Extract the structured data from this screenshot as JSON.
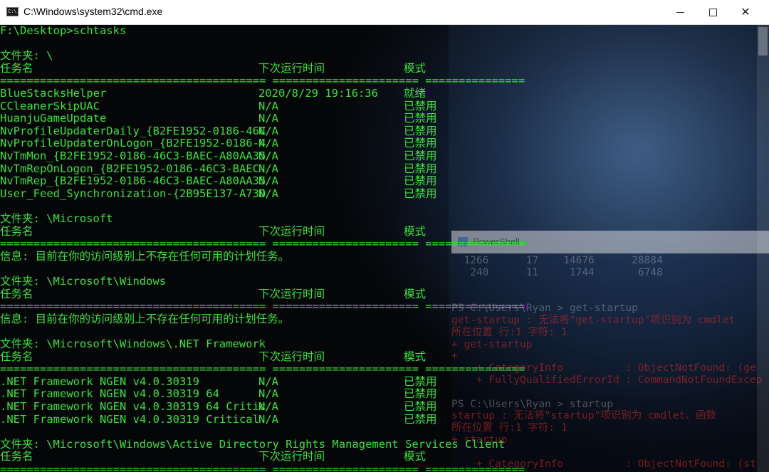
{
  "window": {
    "title": "C:\\Windows\\system32\\cmd.exe",
    "icon_text": "C:\\.",
    "controls": {
      "minimize": "minimize",
      "maximize": "maximize",
      "close": "✕"
    }
  },
  "console": {
    "prompt": "F:\\Desktop>schtasks",
    "sections": [
      {
        "folder": "文件夹: \\",
        "header": {
          "name": "任务名",
          "next_run": "下次运行时间",
          "status": "模式"
        },
        "separator": "======================================== ====================== ===============",
        "rows": [
          {
            "name": "BlueStacksHelper",
            "next_run": "2020/8/29 19:16:36",
            "status": "就绪"
          },
          {
            "name": "CCleanerSkipUAC",
            "next_run": "N/A",
            "status": "已禁用"
          },
          {
            "name": "HuanjuGameUpdate",
            "next_run": "N/A",
            "status": "已禁用"
          },
          {
            "name": "NvProfileUpdaterDaily_{B2FE1952-0186-46C",
            "next_run": "N/A",
            "status": "已禁用"
          },
          {
            "name": "NvProfileUpdaterOnLogon_{B2FE1952-0186-4",
            "next_run": "N/A",
            "status": "已禁用"
          },
          {
            "name": "NvTmMon_{B2FE1952-0186-46C3-BAEC-A80AA35",
            "next_run": "N/A",
            "status": "已禁用"
          },
          {
            "name": "NvTmRepOnLogon_{B2FE1952-0186-46C3-BAEC-",
            "next_run": "N/A",
            "status": "已禁用"
          },
          {
            "name": "NvTmRep_{B2FE1952-0186-46C3-BAEC-A80AA35",
            "next_run": "N/A",
            "status": "已禁用"
          },
          {
            "name": "User_Feed_Synchronization-{2B95E137-A73D",
            "next_run": "N/A",
            "status": "已禁用"
          }
        ]
      },
      {
        "folder": "文件夹: \\Microsoft",
        "header": {
          "name": "任务名",
          "next_run": "下次运行时间",
          "status": "模式"
        },
        "separator": "======================================== ====================== ===============",
        "info": "信息: 目前在你的访问级别上不存在任何可用的计划任务。"
      },
      {
        "folder": "文件夹: \\Microsoft\\Windows",
        "header": {
          "name": "任务名",
          "next_run": "下次运行时间",
          "status": "模式"
        },
        "separator": "======================================== ====================== ===============",
        "info": "信息: 目前在你的访问级别上不存在任何可用的计划任务。"
      },
      {
        "folder": "文件夹: \\Microsoft\\Windows\\.NET Framework",
        "header": {
          "name": "任务名",
          "next_run": "下次运行时间",
          "status": "模式"
        },
        "separator": "======================================== ====================== ===============",
        "rows": [
          {
            "name": ".NET Framework NGEN v4.0.30319",
            "next_run": "N/A",
            "status": "已禁用"
          },
          {
            "name": ".NET Framework NGEN v4.0.30319 64",
            "next_run": "N/A",
            "status": "已禁用"
          },
          {
            "name": ".NET Framework NGEN v4.0.30319 64 Critic",
            "next_run": "N/A",
            "status": "已禁用"
          },
          {
            "name": ".NET Framework NGEN v4.0.30319 Critical",
            "next_run": "N/A",
            "status": "已禁用"
          }
        ]
      },
      {
        "folder": "文件夹: \\Microsoft\\Windows\\Active Directory Rights Management Services Client",
        "header": {
          "name": "任务名",
          "next_run": "下次运行时间",
          "status": "模式"
        },
        "separator": "======================================== ====================== ==============="
      }
    ]
  },
  "background_powershell": {
    "title": "PowerShell",
    "lines": [
      {
        "text": "  1266      17    14676      28884",
        "tone": "white"
      },
      {
        "text": "   240      11     1744       6748",
        "tone": "white"
      },
      {
        "text": "",
        "tone": "white"
      },
      {
        "text": "",
        "tone": "white"
      },
      {
        "text": "PS C:\\Users\\Ryan > get-startup",
        "tone": "white"
      },
      {
        "text": "get-startup : 无法将\"get-startup\"项识别为 cmdlet",
        "tone": "red"
      },
      {
        "text": "所在位置 行:1 字符: 1",
        "tone": "red"
      },
      {
        "text": "+ get-startup",
        "tone": "red"
      },
      {
        "text": "+",
        "tone": "red"
      },
      {
        "text": "    + CategoryInfo          : ObjectNotFound: (ge",
        "tone": "red"
      },
      {
        "text": "    + FullyQualifiedErrorId : CommandNotFoundExcep",
        "tone": "red"
      },
      {
        "text": "",
        "tone": "white"
      },
      {
        "text": "PS C:\\Users\\Ryan > startup",
        "tone": "white"
      },
      {
        "text": "startup : 无法将\"startup\"项识别为 cmdlet、函数",
        "tone": "red"
      },
      {
        "text": "所在位置 行:1 字符: 1",
        "tone": "red"
      },
      {
        "text": "+ startup",
        "tone": "red"
      },
      {
        "text": "",
        "tone": "red"
      },
      {
        "text": "    + CategoryInfo          : ObjectNotFound: (st",
        "tone": "red"
      }
    ]
  },
  "colors": {
    "console_text": "#cfd8cf",
    "highlight_green": "#3ee03e",
    "titlebar_bg": "#ffffff"
  }
}
